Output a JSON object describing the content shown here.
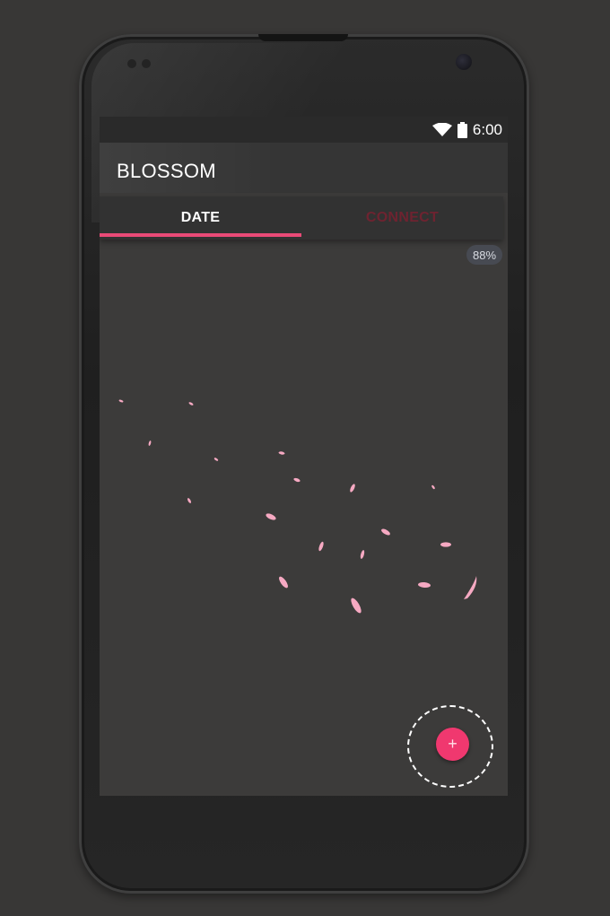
{
  "status_bar": {
    "time": "6:00",
    "icons": [
      "wifi-icon",
      "battery-icon"
    ]
  },
  "app_bar": {
    "title": "BLOSSOM"
  },
  "tabs": [
    {
      "label": "DATE",
      "selected": true
    },
    {
      "label": "CONNECT",
      "selected": false
    }
  ],
  "zoom_badge": "88%",
  "fab": {
    "icon": "plus-icon",
    "glyph": "+"
  },
  "colors": {
    "accent": "#e94a77",
    "fab": "#f0386f",
    "petal": "#f6a9c2",
    "background": "#3c3b3a"
  }
}
